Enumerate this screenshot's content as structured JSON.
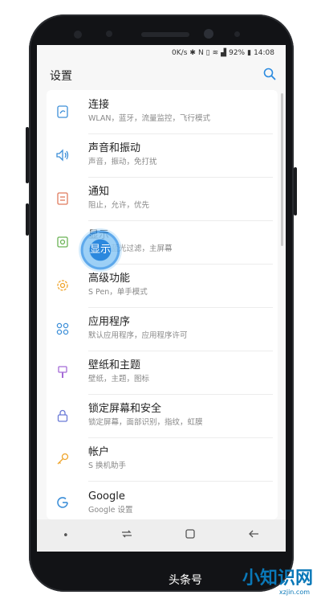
{
  "status": {
    "speed": "0K/s",
    "battery": "92%",
    "time": "14:08"
  },
  "header": {
    "title": "设置",
    "search_icon": "search-icon"
  },
  "items": [
    {
      "title": "连接",
      "subtitle": "WLAN，蓝牙，流量监控，飞行模式",
      "icon": "connections-icon",
      "color": "#3d8fd8"
    },
    {
      "title": "声音和振动",
      "subtitle": "声音，振动，免打扰",
      "icon": "speaker-icon",
      "color": "#3d8fd8"
    },
    {
      "title": "通知",
      "subtitle": "阻止，允许，优先",
      "icon": "notification-icon",
      "color": "#e07b5e"
    },
    {
      "title": "显示",
      "subtitle": "亮度，蓝光过滤，主屏幕",
      "icon": "display-icon",
      "color": "#6bb356"
    },
    {
      "title": "高级功能",
      "subtitle": "S Pen，单手模式",
      "icon": "advanced-features-icon",
      "color": "#efa42c"
    },
    {
      "title": "应用程序",
      "subtitle": "默认应用程序，应用程序许可",
      "icon": "apps-icon",
      "color": "#3d8fd8"
    },
    {
      "title": "壁纸和主题",
      "subtitle": "壁纸，主题，图标",
      "icon": "brush-icon",
      "color": "#a56ad6"
    },
    {
      "title": "锁定屏幕和安全",
      "subtitle": "锁定屏幕，面部识别，指纹，虹膜",
      "icon": "lock-icon",
      "color": "#6a7ad6"
    },
    {
      "title": "帐户",
      "subtitle": "S 换机助手",
      "icon": "key-icon",
      "color": "#efa42c"
    },
    {
      "title": "Google",
      "subtitle": "Google 设置",
      "icon": "google-icon",
      "color": "#3d8fd8"
    }
  ],
  "touch_label": "显示",
  "navbar": {
    "recent": "recent-apps-icon",
    "home": "home-icon",
    "back": "back-icon"
  },
  "watermark": {
    "text1": "头条号",
    "text2": "小知识网",
    "url": "xzjin.com"
  }
}
